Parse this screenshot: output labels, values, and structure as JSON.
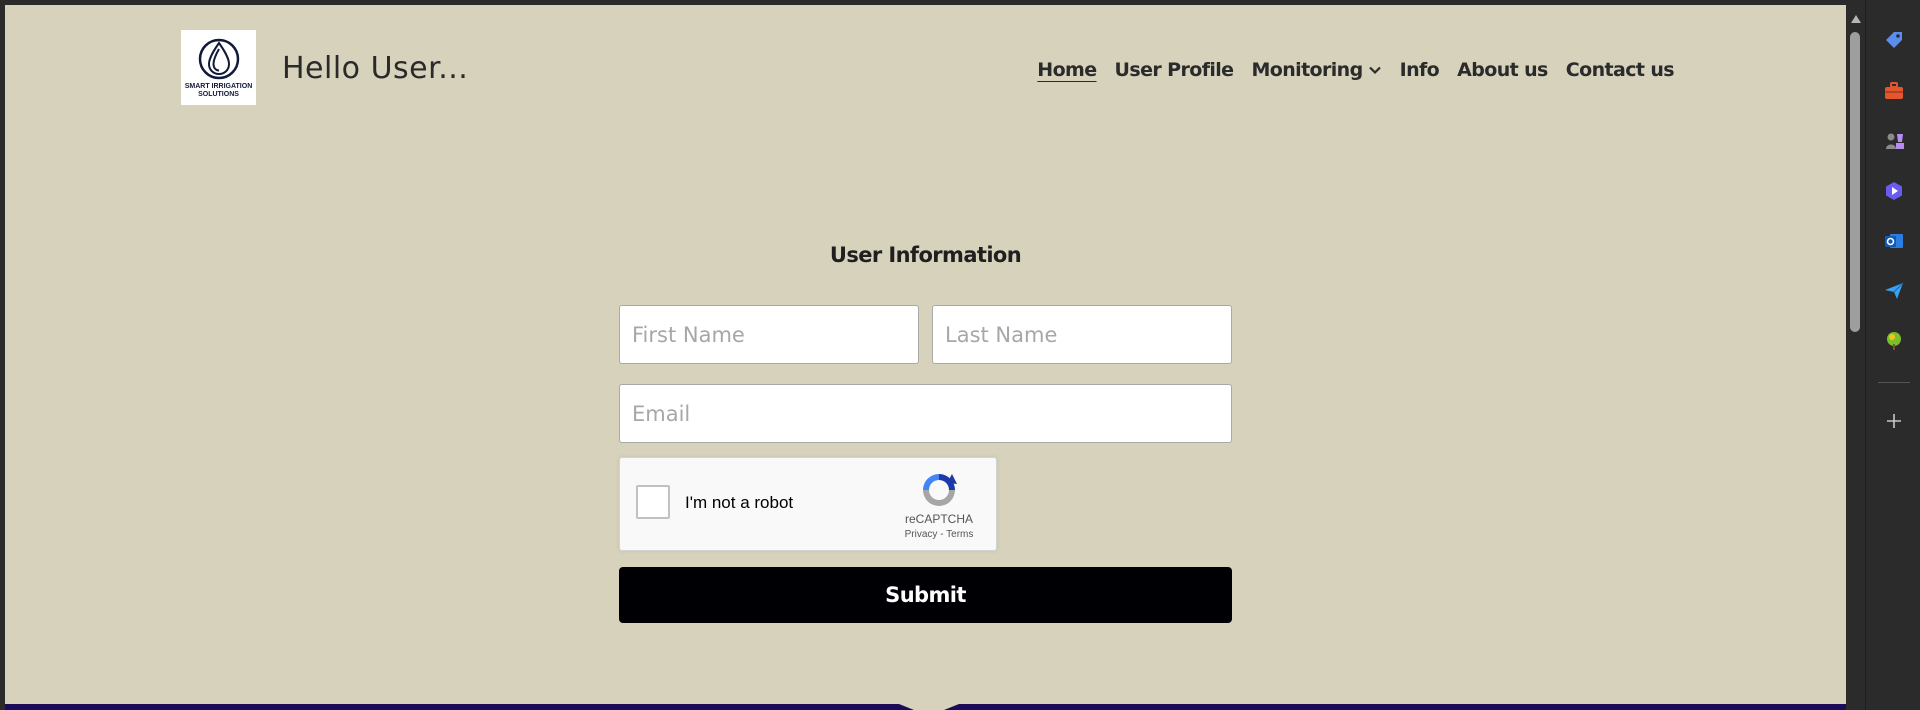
{
  "header": {
    "logo_text": "SMART IRRIGATION SOLUTIONS",
    "greeting": "Hello User..."
  },
  "nav": {
    "items": [
      {
        "label": "Home",
        "active": true
      },
      {
        "label": "User Profile"
      },
      {
        "label": "Monitoring",
        "has_dropdown": true
      },
      {
        "label": "Info"
      },
      {
        "label": "About us"
      },
      {
        "label": "Contact us"
      }
    ]
  },
  "form": {
    "title": "User Information",
    "first_name": {
      "placeholder": "First Name",
      "value": ""
    },
    "last_name": {
      "placeholder": "Last Name",
      "value": ""
    },
    "email": {
      "placeholder": "Email",
      "value": ""
    },
    "captcha": {
      "label": "I'm not a robot",
      "brand": "reCAPTCHA",
      "privacy": "Privacy",
      "separator": "-",
      "terms": "Terms"
    },
    "submit_label": "Submit"
  },
  "colors": {
    "page_bg": "#d6d2bc",
    "submit_bg": "#000004",
    "footer": "#1c0b58"
  },
  "side_rail": {
    "icons": [
      "tag-icon",
      "briefcase-icon",
      "chess-icon",
      "copilot-icon",
      "outlook-icon",
      "send-icon",
      "tree-icon",
      "add-icon"
    ]
  }
}
